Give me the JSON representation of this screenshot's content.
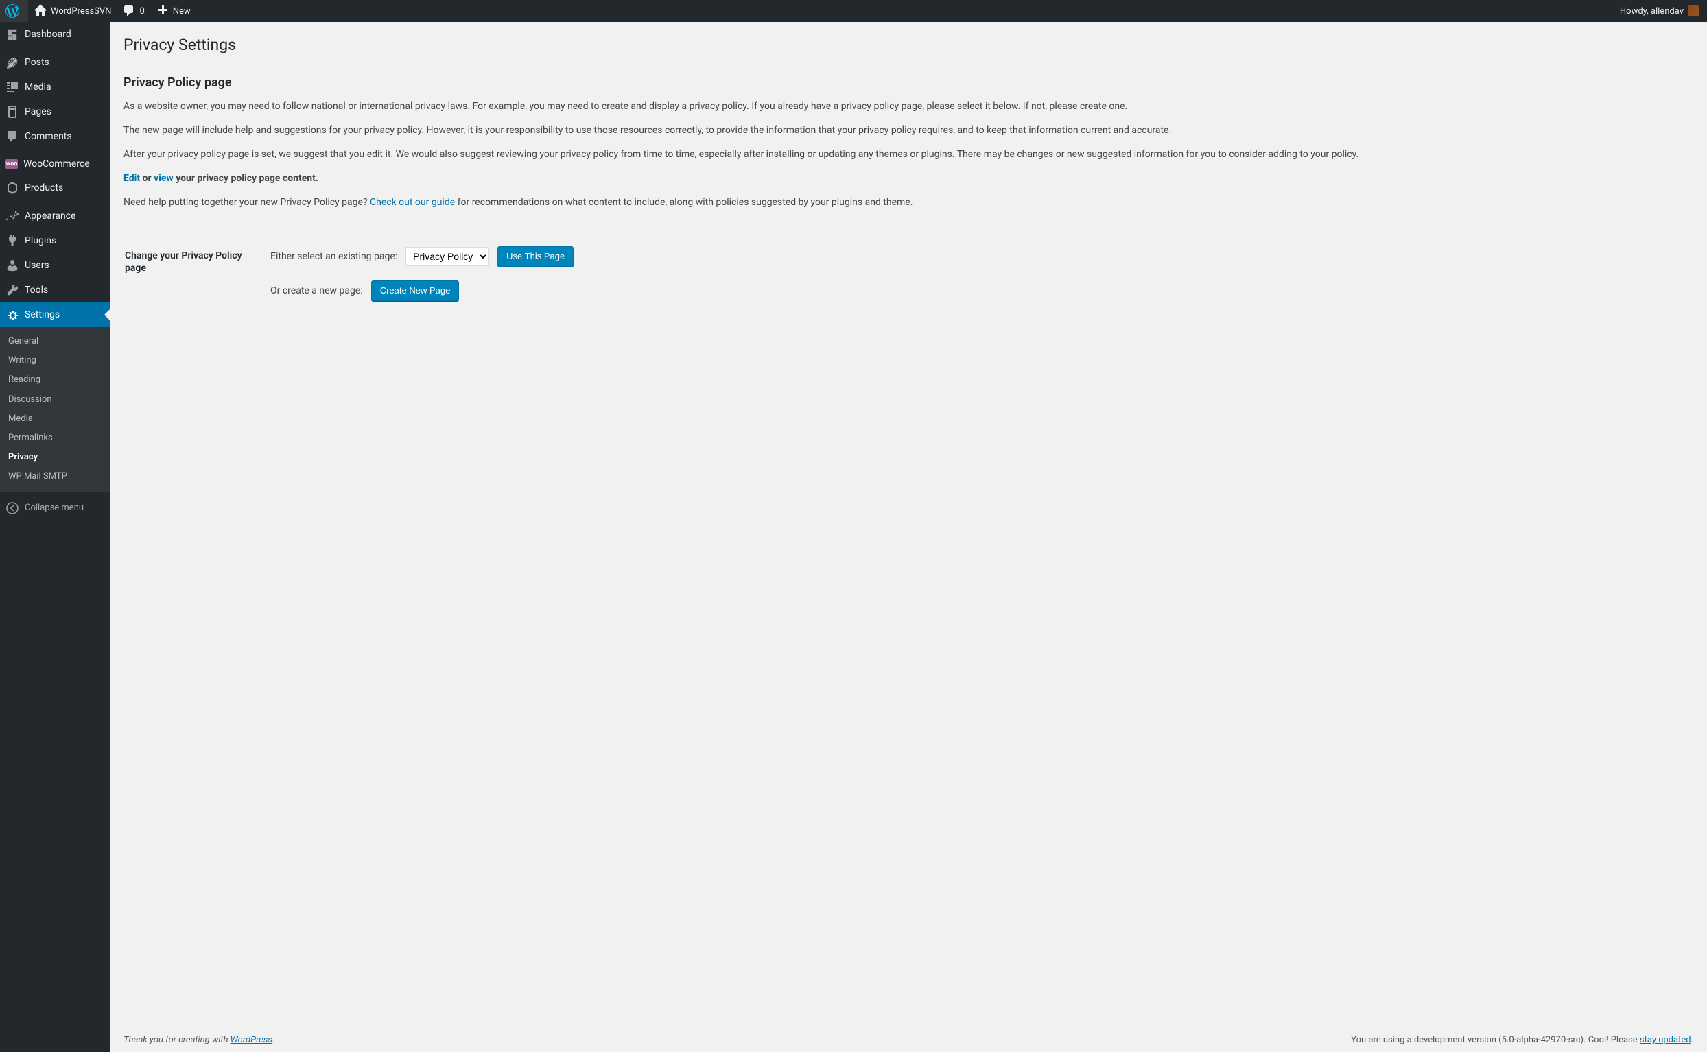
{
  "adminbar": {
    "site_name": "WordPressSVN",
    "comments_count": "0",
    "new_label": "New",
    "howdy": "Howdy, allendav"
  },
  "sidebar": {
    "items": [
      {
        "label": "Dashboard"
      },
      {
        "label": "Posts"
      },
      {
        "label": "Media"
      },
      {
        "label": "Pages"
      },
      {
        "label": "Comments"
      },
      {
        "label": "WooCommerce"
      },
      {
        "label": "Products"
      },
      {
        "label": "Appearance"
      },
      {
        "label": "Plugins"
      },
      {
        "label": "Users"
      },
      {
        "label": "Tools"
      },
      {
        "label": "Settings"
      }
    ],
    "submenu": [
      {
        "label": "General"
      },
      {
        "label": "Writing"
      },
      {
        "label": "Reading"
      },
      {
        "label": "Discussion"
      },
      {
        "label": "Media"
      },
      {
        "label": "Permalinks"
      },
      {
        "label": "Privacy"
      },
      {
        "label": "WP Mail SMTP"
      }
    ],
    "collapse_label": "Collapse menu"
  },
  "main": {
    "page_title": "Privacy Settings",
    "section_title": "Privacy Policy page",
    "para1": "As a website owner, you may need to follow national or international privacy laws. For example, you may need to create and display a privacy policy. If you already have a privacy policy page, please select it below. If not, please create one.",
    "para2": "The new page will include help and suggestions for your privacy policy. However, it is your responsibility to use those resources correctly, to provide the information that your privacy policy requires, and to keep that information current and accurate.",
    "para3": "After your privacy policy page is set, we suggest that you edit it. We would also suggest reviewing your privacy policy from time to time, especially after installing or updating any themes or plugins. There may be changes or new suggested information for you to consider adding to your policy.",
    "edit_link": "Edit",
    "edit_or": " or ",
    "view_link": "view",
    "edit_suffix": " your privacy policy page content.",
    "help_prefix": "Need help putting together your new Privacy Policy page? ",
    "help_link": "Check out our guide",
    "help_suffix": " for recommendations on what content to include, along with policies suggested by your plugins and theme.",
    "change_label": "Change your Privacy Policy page",
    "select_label": "Either select an existing page:",
    "select_value": "Privacy Policy",
    "use_button": "Use This Page",
    "create_label": "Or create a new page:",
    "create_button": "Create New Page"
  },
  "footer": {
    "thanks_prefix": "Thank you for creating with ",
    "thanks_link": "WordPress",
    "thanks_suffix": ".",
    "version_prefix": "You are using a development version (5.0-alpha-42970-src). Cool! Please ",
    "version_link": "stay updated",
    "version_suffix": "."
  }
}
